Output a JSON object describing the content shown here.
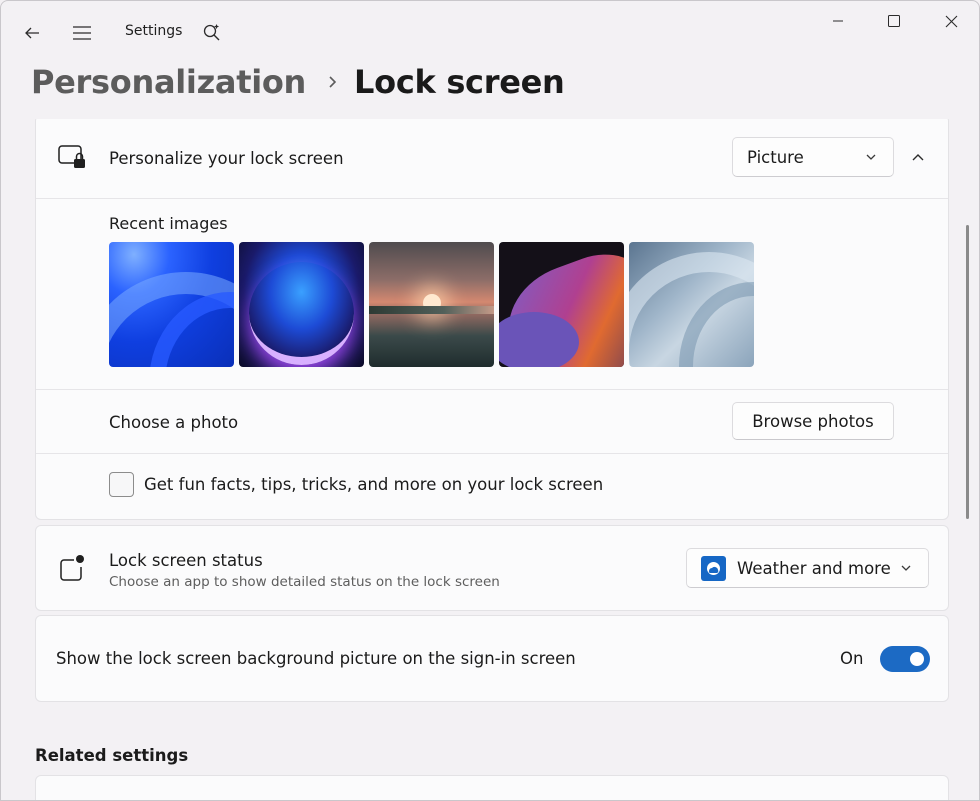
{
  "window": {
    "app_title": "Settings"
  },
  "breadcrumb": {
    "parent": "Personalization",
    "current": "Lock screen"
  },
  "lock_screen": {
    "personalize_title": "Personalize your lock screen",
    "personalize_value": "Picture",
    "recent_images_label": "Recent images",
    "recent_images": [
      "wallpaper-blue-bloom",
      "wallpaper-glow-orb",
      "wallpaper-sunset-lake",
      "wallpaper-ribbon-flow",
      "wallpaper-grey-bloom"
    ],
    "choose_photo_label": "Choose a photo",
    "browse_button": "Browse photos",
    "fun_facts_label": "Get fun facts, tips, tricks, and more on your lock screen",
    "fun_facts_checked": false
  },
  "status": {
    "title": "Lock screen status",
    "subtitle": "Choose an app to show detailed status on the lock screen",
    "value": "Weather and more",
    "app_icon": "weather-app-icon"
  },
  "signin": {
    "label": "Show the lock screen background picture on the sign-in screen",
    "toggle_state": "On",
    "toggle_on": true,
    "toggle_color": "#1c6ac4"
  },
  "related": {
    "title": "Related settings"
  }
}
